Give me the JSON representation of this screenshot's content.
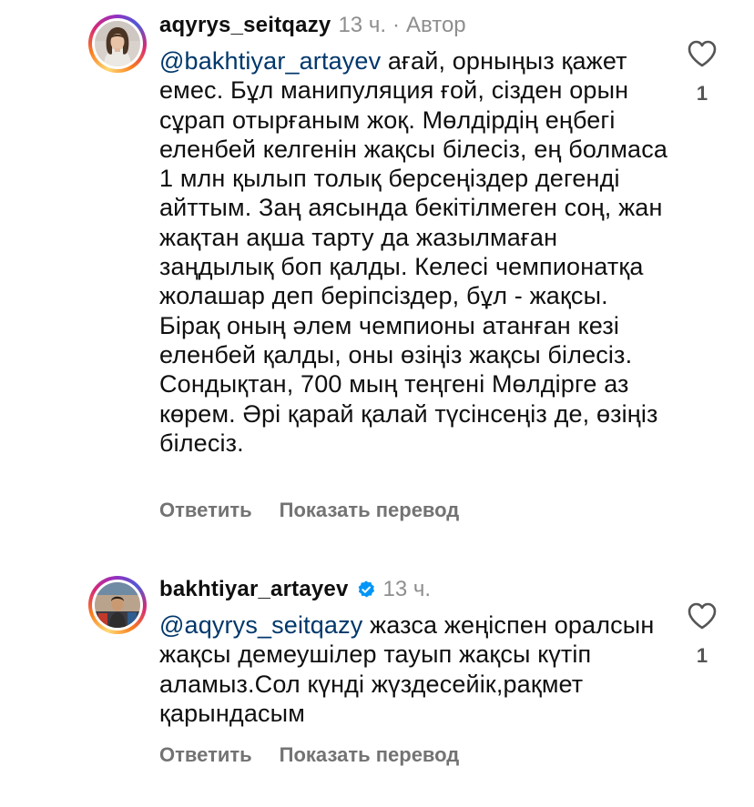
{
  "comments": [
    {
      "username": "aqyrys_seitqazy",
      "time": "13 ч.",
      "separator": "·",
      "author_tag": "Автор",
      "mention": "@bakhtiyar_artayev",
      "text": " ағай, орныңыз қажет емес. Бұл манипуляция ғой, сізден орын сұрап отырғаным жоқ. Мөлдірдің еңбегі еленбей келгенін жақсы білесіз, ең болмаса 1 млн қылып толық берсеңіздер дегенді айттым. Заң аясында бекітілмеген соң, жан жақтан ақша тарту да жазылмаған заңдылық боп қалды. Келесі чемпионатқа жолашар деп беріпсіздер, бұл - жақсы. Бірақ оның әлем чемпионы атанған кезі еленбей қалды, оны өзіңіз жақсы білесіз. Сондықтан, 700 мың теңгені Мөлдірге аз көрем. Әрі қарай қалай түсінсеңіз де, өзіңіз білесіз.",
      "reply_label": "Ответить",
      "translate_label": "Показать перевод",
      "like_count": "1",
      "avatar_icon": "woman-portrait-avatar"
    },
    {
      "username": "bakhtiyar_artayev",
      "verified": true,
      "time": "13 ч.",
      "mention": "@aqyrys_seitqazy",
      "text": " жазса жеңіспен оралсын жақсы демеушілер тауып жақсы күтіп аламыз.Сол күнді жүздесейік,рақмет қарындасым",
      "reply_label": "Ответить",
      "translate_label": "Показать перевод",
      "like_count": "1",
      "avatar_icon": "man-portrait-avatar"
    }
  ],
  "colors": {
    "mention": "#00376b",
    "secondary_text": "#8e8e8e",
    "action_text": "#737373",
    "verified_badge": "#0095f6"
  }
}
